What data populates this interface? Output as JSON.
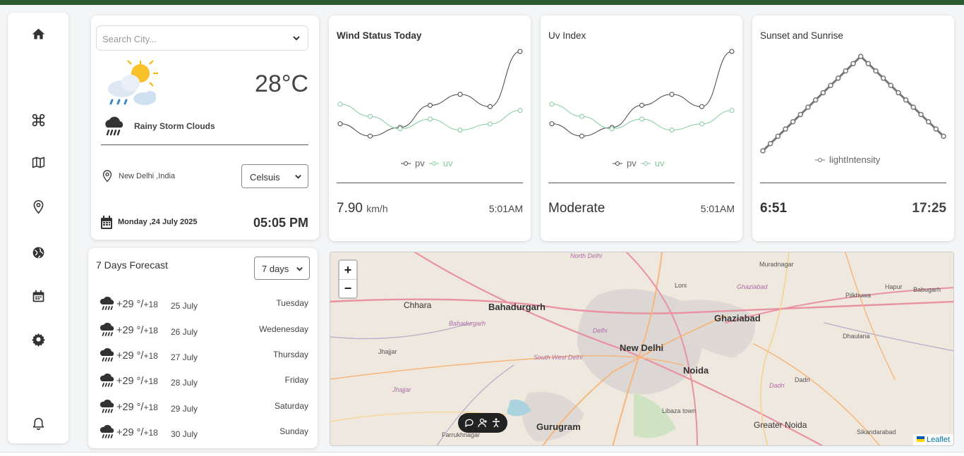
{
  "sidebar": {
    "items": [
      "home-icon",
      "command-icon",
      "map-icon",
      "location-pin-icon",
      "globe-icon",
      "calendar-icon",
      "settings-icon",
      "bell-icon"
    ]
  },
  "weather": {
    "search_placeholder": "Search City...",
    "temperature": "28°C",
    "condition": "Rainy Storm Clouds",
    "location": "New Delhi ,India",
    "unit": "Celsuis",
    "date": "Monday ,24 July 2025",
    "time": "05:05 PM"
  },
  "wind": {
    "title": "Wind Status Today",
    "legend_pv": "pv",
    "legend_uv": "uv",
    "value": "7.90",
    "unit": "km/h",
    "time": "5:01AM"
  },
  "uv": {
    "title": "Uv Index",
    "legend_pv": "pv",
    "legend_uv": "uv",
    "value": "Moderate",
    "time": "5:01AM"
  },
  "sun": {
    "title": "Sunset and Sunrise",
    "legend": "lightIntensity",
    "sunrise": "6:51",
    "sunset": "17:25"
  },
  "chart_data": [
    {
      "type": "line",
      "title": "Wind Status Today",
      "x": [
        1,
        2,
        3,
        4,
        5,
        6,
        7
      ],
      "series": [
        {
          "name": "pv",
          "values": [
            2400,
            1398,
            2100,
            3908,
            4800,
            3800,
            8300
          ]
        },
        {
          "name": "uv",
          "values": [
            4000,
            3000,
            2000,
            2780,
            1890,
            2390,
            3490
          ]
        }
      ],
      "colors": {
        "pv": "#444444",
        "uv": "#82ca9d"
      }
    },
    {
      "type": "line",
      "title": "Uv Index",
      "x": [
        1,
        2,
        3,
        4,
        5,
        6,
        7
      ],
      "series": [
        {
          "name": "pv",
          "values": [
            2400,
            1398,
            2100,
            3908,
            4800,
            3800,
            8300
          ]
        },
        {
          "name": "uv",
          "values": [
            4000,
            3000,
            2000,
            2780,
            1890,
            2390,
            3490
          ]
        }
      ],
      "colors": {
        "pv": "#444444",
        "uv": "#82ca9d"
      }
    },
    {
      "type": "line",
      "title": "Sunset and Sunrise",
      "series": [
        {
          "name": "lightIntensity",
          "values": [
            0,
            1,
            2,
            3,
            4,
            5,
            6,
            7,
            8,
            9,
            10,
            11,
            12,
            13,
            12,
            11,
            10,
            9,
            8,
            7,
            6,
            5,
            4,
            3,
            2
          ]
        }
      ],
      "colors": {
        "lightIntensity": "#777777"
      }
    }
  ],
  "forecast": {
    "title": "7 Days Forecast",
    "range": "7 days",
    "days": [
      {
        "high": "+29 °/",
        "low": "+18",
        "date": "25 July",
        "day": "Tuesday"
      },
      {
        "high": "+29 °/",
        "low": "+18",
        "date": "26 July",
        "day": "Wedenesday"
      },
      {
        "high": "+29 °/",
        "low": "+18",
        "date": "27 July",
        "day": "Thursday"
      },
      {
        "high": "+29 °/",
        "low": "+18",
        "date": "28 July",
        "day": "Friday"
      },
      {
        "high": "+29 °/",
        "low": "+18",
        "date": "29 July",
        "day": "Saturday"
      },
      {
        "high": "+29 °/",
        "low": "+18",
        "date": "30 July",
        "day": "Sunday"
      }
    ]
  },
  "map": {
    "zoom_in": "+",
    "zoom_out": "−",
    "attribution": "Leaflet",
    "labels": [
      "North Delhi",
      "Muradnagar",
      "Chhara",
      "Bahadurgarh",
      "Bahadurgarh",
      "Delhi",
      "Ghaziabad",
      "Ghaziabad",
      "Loni",
      "Pilkhuwa",
      "Hapur",
      "Babugarh",
      "New Delhi",
      "Jhajjar",
      "South West Delhi",
      "Noida",
      "Dhaulana",
      "Jhajjar",
      "Dadri",
      "Dadri",
      "Libaza town",
      "Gurugram",
      "Greater Noida",
      "Farrukhnagar",
      "Sikandarabad"
    ]
  }
}
